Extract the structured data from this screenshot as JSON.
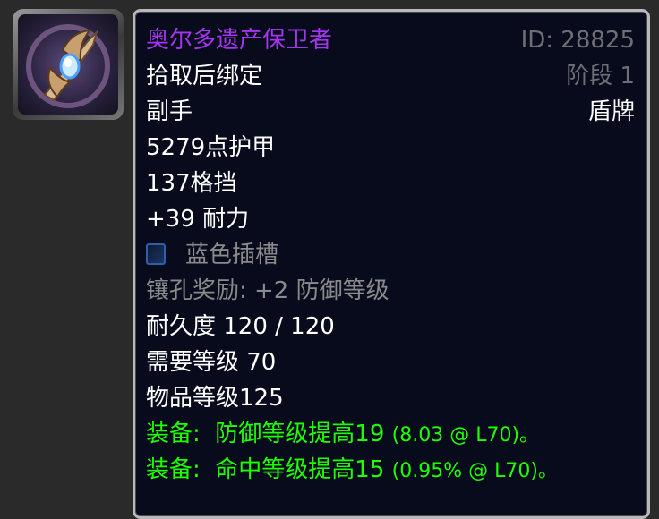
{
  "item": {
    "name": "奥尔多遗产保卫者",
    "id_label": "ID: 28825",
    "binding": "拾取后绑定",
    "phase": "阶段 1",
    "slot": "副手",
    "type": "盾牌",
    "armor": "5279点护甲",
    "block": "137格挡",
    "stamina": "+39 耐力",
    "socket": "蓝色插槽",
    "socket_bonus": "镶孔奖励: +2 防御等级",
    "durability": "耐久度 120 / 120",
    "required_level": "需要等级 70",
    "item_level": "物品等级125",
    "equip_1_prefix": "装备:",
    "equip_1_text": "防御等级提高19",
    "equip_1_detail": "(8.03 @ L70)。",
    "equip_2_prefix": "装备:",
    "equip_2_text": "命中等级提高15",
    "equip_2_detail": "(0.95% @ L70)。"
  },
  "colors": {
    "epic": "#a335ee",
    "equip": "#1eff00",
    "inactive": "#8a8a8a",
    "background": "#070b1c",
    "border": "#b9b9b9"
  },
  "icons": {
    "item_icon": "shield-item-icon",
    "socket_icon": "blue-socket-icon"
  }
}
